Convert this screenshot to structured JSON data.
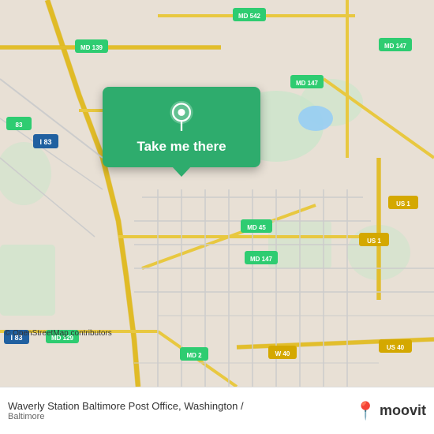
{
  "map": {
    "attribution": "© OpenStreetMap contributors",
    "center_lat": 39.325,
    "center_lng": -76.615,
    "background_color": "#e8e0d5"
  },
  "popup": {
    "label": "Take me there",
    "pin_icon": "location-pin"
  },
  "footer": {
    "title": "Waverly Station Baltimore Post Office, Washington /",
    "subtitle": "Baltimore",
    "moovit_text": "moovit",
    "moovit_pin_color": "#e74c3c"
  },
  "road_labels": [
    "MD 139",
    "MD 542",
    "MD 147",
    "MD 147",
    "US 1",
    "MD 45",
    "MD 2",
    "I 83",
    "MD 129",
    "W 40",
    "US 40"
  ]
}
